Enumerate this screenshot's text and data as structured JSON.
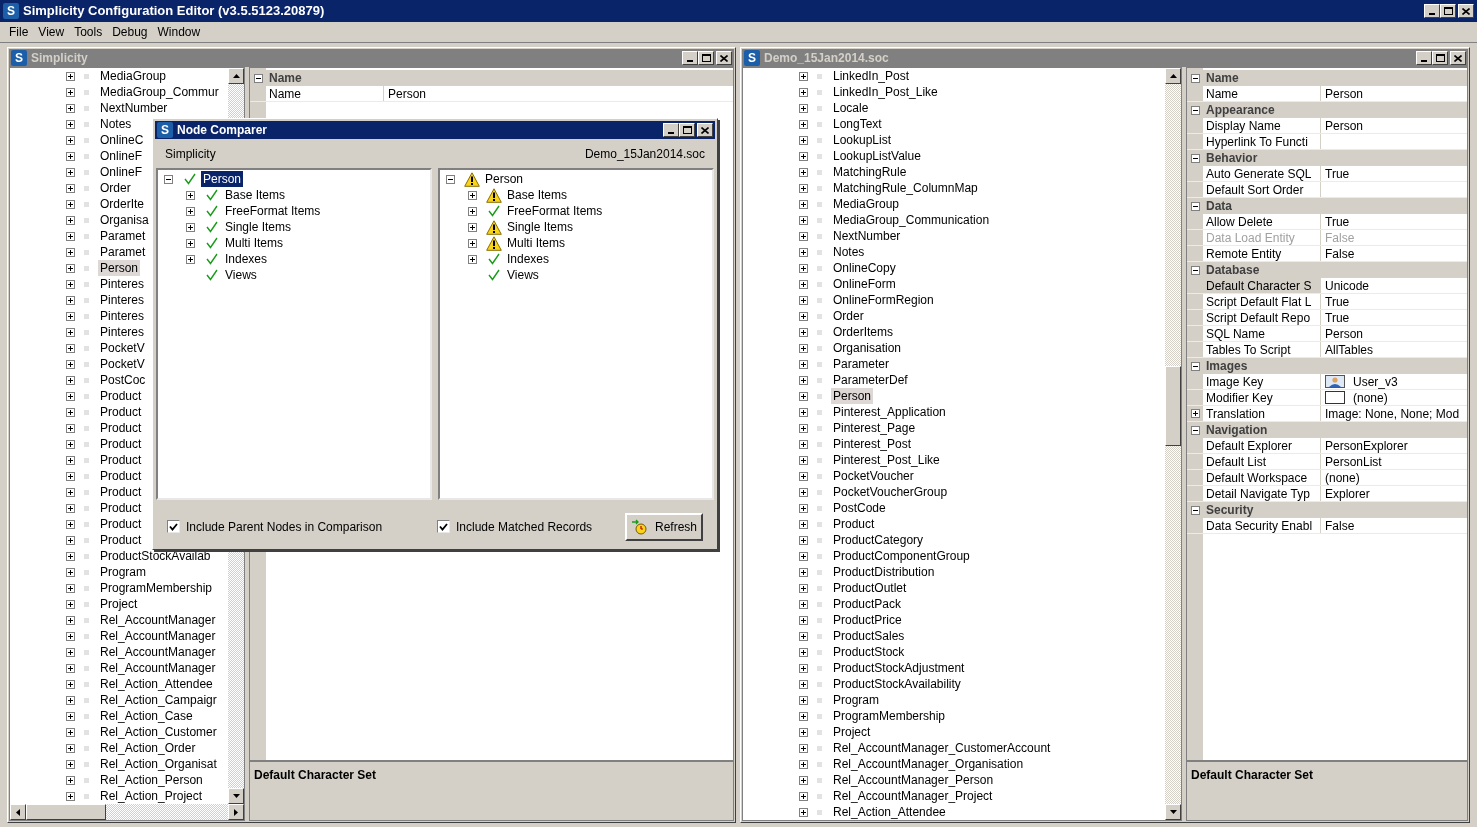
{
  "window": {
    "icon_letter": "S",
    "title": "Simplicity Configuration Editor (v3.5.5123.20879)"
  },
  "menu": [
    "File",
    "View",
    "Tools",
    "Debug",
    "Window"
  ],
  "left_window": {
    "icon_letter": "S",
    "title": "Simplicity",
    "tree": [
      {
        "label": "MediaGroup",
        "selected": false
      },
      {
        "label": "MediaGroup_Commur",
        "selected": false
      },
      {
        "label": "NextNumber",
        "selected": false
      },
      {
        "label": "Notes",
        "selected": false
      },
      {
        "label": "OnlineC",
        "selected": false
      },
      {
        "label": "OnlineF",
        "selected": false
      },
      {
        "label": "OnlineF",
        "selected": false
      },
      {
        "label": "Order",
        "selected": false
      },
      {
        "label": "OrderIte",
        "selected": false
      },
      {
        "label": "Organisa",
        "selected": false
      },
      {
        "label": "Paramet",
        "selected": false
      },
      {
        "label": "Paramet",
        "selected": false
      },
      {
        "label": "Person",
        "selected": true
      },
      {
        "label": "Pinteres",
        "selected": false
      },
      {
        "label": "Pinteres",
        "selected": false
      },
      {
        "label": "Pinteres",
        "selected": false
      },
      {
        "label": "Pinteres",
        "selected": false
      },
      {
        "label": "PocketV",
        "selected": false
      },
      {
        "label": "PocketV",
        "selected": false
      },
      {
        "label": "PostCoc",
        "selected": false
      },
      {
        "label": "Product",
        "selected": false
      },
      {
        "label": "Product",
        "selected": false
      },
      {
        "label": "Product",
        "selected": false
      },
      {
        "label": "Product",
        "selected": false
      },
      {
        "label": "Product",
        "selected": false
      },
      {
        "label": "Product",
        "selected": false
      },
      {
        "label": "Product",
        "selected": false
      },
      {
        "label": "Product",
        "selected": false
      },
      {
        "label": "Product",
        "selected": false
      },
      {
        "label": "Product",
        "selected": false
      },
      {
        "label": "ProductStockAvailab",
        "selected": false
      },
      {
        "label": "Program",
        "selected": false
      },
      {
        "label": "ProgramMembership",
        "selected": false
      },
      {
        "label": "Project",
        "selected": false
      },
      {
        "label": "Rel_AccountManager",
        "selected": false
      },
      {
        "label": "Rel_AccountManager",
        "selected": false
      },
      {
        "label": "Rel_AccountManager",
        "selected": false
      },
      {
        "label": "Rel_AccountManager",
        "selected": false
      },
      {
        "label": "Rel_Action_Attendee",
        "selected": false
      },
      {
        "label": "Rel_Action_Campaigr",
        "selected": false
      },
      {
        "label": "Rel_Action_Case",
        "selected": false
      },
      {
        "label": "Rel_Action_Customer",
        "selected": false
      },
      {
        "label": "Rel_Action_Order",
        "selected": false
      },
      {
        "label": "Rel_Action_Organisat",
        "selected": false
      },
      {
        "label": "Rel_Action_Person",
        "selected": false
      },
      {
        "label": "Rel_Action_Project",
        "selected": false
      }
    ],
    "properties": {
      "categories": [
        {
          "name": "Name",
          "rows": [
            {
              "label": "Name",
              "value": "Person",
              "disabled": false,
              "selected": false
            }
          ]
        }
      ]
    },
    "description": "Default Character Set"
  },
  "right_window": {
    "icon_letter": "S",
    "title": "Demo_15Jan2014.soc",
    "tree": [
      {
        "label": "LinkedIn_Post",
        "selected": false
      },
      {
        "label": "LinkedIn_Post_Like",
        "selected": false
      },
      {
        "label": "Locale",
        "selected": false
      },
      {
        "label": "LongText",
        "selected": false
      },
      {
        "label": "LookupList",
        "selected": false
      },
      {
        "label": "LookupListValue",
        "selected": false
      },
      {
        "label": "MatchingRule",
        "selected": false
      },
      {
        "label": "MatchingRule_ColumnMap",
        "selected": false
      },
      {
        "label": "MediaGroup",
        "selected": false
      },
      {
        "label": "MediaGroup_Communication",
        "selected": false
      },
      {
        "label": "NextNumber",
        "selected": false
      },
      {
        "label": "Notes",
        "selected": false
      },
      {
        "label": "OnlineCopy",
        "selected": false
      },
      {
        "label": "OnlineForm",
        "selected": false
      },
      {
        "label": "OnlineFormRegion",
        "selected": false
      },
      {
        "label": "Order",
        "selected": false
      },
      {
        "label": "OrderItems",
        "selected": false
      },
      {
        "label": "Organisation",
        "selected": false
      },
      {
        "label": "Parameter",
        "selected": false
      },
      {
        "label": "ParameterDef",
        "selected": false
      },
      {
        "label": "Person",
        "selected": true
      },
      {
        "label": "Pinterest_Application",
        "selected": false
      },
      {
        "label": "Pinterest_Page",
        "selected": false
      },
      {
        "label": "Pinterest_Post",
        "selected": false
      },
      {
        "label": "Pinterest_Post_Like",
        "selected": false
      },
      {
        "label": "PocketVoucher",
        "selected": false
      },
      {
        "label": "PocketVoucherGroup",
        "selected": false
      },
      {
        "label": "PostCode",
        "selected": false
      },
      {
        "label": "Product",
        "selected": false
      },
      {
        "label": "ProductCategory",
        "selected": false
      },
      {
        "label": "ProductComponentGroup",
        "selected": false
      },
      {
        "label": "ProductDistribution",
        "selected": false
      },
      {
        "label": "ProductOutlet",
        "selected": false
      },
      {
        "label": "ProductPack",
        "selected": false
      },
      {
        "label": "ProductPrice",
        "selected": false
      },
      {
        "label": "ProductSales",
        "selected": false
      },
      {
        "label": "ProductStock",
        "selected": false
      },
      {
        "label": "ProductStockAdjustment",
        "selected": false
      },
      {
        "label": "ProductStockAvailability",
        "selected": false
      },
      {
        "label": "Program",
        "selected": false
      },
      {
        "label": "ProgramMembership",
        "selected": false
      },
      {
        "label": "Project",
        "selected": false
      },
      {
        "label": "Rel_AccountManager_CustomerAccount",
        "selected": false
      },
      {
        "label": "Rel_AccountManager_Organisation",
        "selected": false
      },
      {
        "label": "Rel_AccountManager_Person",
        "selected": false
      },
      {
        "label": "Rel_AccountManager_Project",
        "selected": false
      },
      {
        "label": "Rel_Action_Attendee",
        "selected": false
      }
    ],
    "properties": {
      "categories": [
        {
          "name": "Name",
          "rows": [
            {
              "label": "Name",
              "value": "Person",
              "kind": "text",
              "disabled": false,
              "selected": false
            }
          ]
        },
        {
          "name": "Appearance",
          "rows": [
            {
              "label": "Display Name",
              "value": "Person",
              "kind": "text",
              "disabled": false,
              "selected": false
            },
            {
              "label": "Hyperlink To Functi",
              "kind": "text",
              "disabled": false,
              "selected": false
            }
          ]
        },
        {
          "name": "Behavior",
          "rows": [
            {
              "label": "Auto Generate SQL",
              "value": "True",
              "kind": "text",
              "disabled": false,
              "selected": false
            },
            {
              "label": "Default Sort Order",
              "kind": "text",
              "disabled": false,
              "selected": false
            }
          ]
        },
        {
          "name": "Data",
          "rows": [
            {
              "label": "Allow Delete",
              "value": "True",
              "kind": "text",
              "disabled": false,
              "selected": false
            },
            {
              "label": "Data Load Entity",
              "value": "False",
              "kind": "text",
              "disabled": true,
              "selected": false
            },
            {
              "label": "Remote Entity",
              "value": "False",
              "kind": "text",
              "disabled": false,
              "selected": false
            }
          ]
        },
        {
          "name": "Database",
          "rows": [
            {
              "label": "Default Character S",
              "value": "Unicode",
              "kind": "text",
              "disabled": false,
              "selected": true
            },
            {
              "label": "Script Default Flat L",
              "value": "True",
              "kind": "text",
              "disabled": false,
              "selected": false
            },
            {
              "label": "Script Default Repo",
              "value": "True",
              "kind": "text",
              "disabled": false,
              "selected": false
            },
            {
              "label": "SQL Name",
              "value": "Person",
              "kind": "text",
              "disabled": false,
              "selected": false
            },
            {
              "label": "Tables To Script",
              "value": "AllTables",
              "kind": "text",
              "disabled": false,
              "selected": false
            }
          ]
        },
        {
          "name": "Images",
          "rows": [
            {
              "label": "Image Key",
              "value": "User_v3",
              "kind": "image",
              "filled": true,
              "disabled": false,
              "selected": false
            },
            {
              "label": "Modifier Key",
              "value": "(none)",
              "kind": "image",
              "filled": false,
              "disabled": false,
              "selected": false
            },
            {
              "label": "Translation",
              "value": "Image: None, None; Mod",
              "kind": "expandable",
              "disabled": false,
              "selected": false
            }
          ]
        },
        {
          "name": "Navigation",
          "rows": [
            {
              "label": "Default Explorer",
              "value": "PersonExplorer",
              "kind": "text",
              "disabled": false,
              "selected": false
            },
            {
              "label": "Default List",
              "value": "PersonList",
              "kind": "text",
              "disabled": false,
              "selected": false
            },
            {
              "label": "Default Workspace",
              "value": "(none)",
              "kind": "text",
              "disabled": false,
              "selected": false
            },
            {
              "label": "Detail Navigate Typ",
              "value": "Explorer",
              "kind": "text",
              "disabled": false,
              "selected": false
            }
          ]
        },
        {
          "name": "Security",
          "rows": [
            {
              "label": "Data Security Enabl",
              "value": "False",
              "kind": "text",
              "disabled": false,
              "selected": false
            }
          ]
        }
      ]
    },
    "description": "Default Character Set"
  },
  "dialog": {
    "icon_letter": "S",
    "title": "Node Comparer",
    "left_label": "Simplicity",
    "right_label": "Demo_15Jan2014.soc",
    "left_tree": {
      "label": "Person",
      "warning": false,
      "expandable": true,
      "expanded": true,
      "selected": true,
      "children": [
        {
          "label": "Base Items",
          "warning": false,
          "expandable": true,
          "expanded": false,
          "selected": false
        },
        {
          "label": "FreeFormat Items",
          "warning": false,
          "expandable": true,
          "expanded": false,
          "selected": false
        },
        {
          "label": "Single Items",
          "warning": false,
          "expandable": true,
          "expanded": false,
          "selected": false
        },
        {
          "label": "Multi Items",
          "warning": false,
          "expandable": true,
          "expanded": false,
          "selected": false
        },
        {
          "label": "Indexes",
          "warning": false,
          "expandable": true,
          "expanded": false,
          "selected": false
        },
        {
          "label": "Views",
          "warning": false,
          "expandable": false,
          "selected": false
        }
      ]
    },
    "right_tree": {
      "label": "Person",
      "warning": true,
      "expandable": true,
      "expanded": true,
      "selected": false,
      "children": [
        {
          "label": "Base Items",
          "warning": true,
          "expandable": true,
          "expanded": false,
          "selected": false
        },
        {
          "label": "FreeFormat Items",
          "warning": false,
          "expandable": true,
          "expanded": false,
          "selected": false
        },
        {
          "label": "Single Items",
          "warning": true,
          "expandable": true,
          "expanded": false,
          "selected": false
        },
        {
          "label": "Multi Items",
          "warning": true,
          "expandable": true,
          "expanded": false,
          "selected": false
        },
        {
          "label": "Indexes",
          "warning": false,
          "expandable": true,
          "expanded": false,
          "selected": false
        },
        {
          "label": "Views",
          "warning": false,
          "expandable": false,
          "selected": false
        }
      ]
    },
    "options": [
      {
        "label": "Include Parent Nodes in Comparison",
        "checked": true
      },
      {
        "label": "Include Matched Records",
        "checked": true
      }
    ],
    "refresh_button": "Refresh"
  }
}
